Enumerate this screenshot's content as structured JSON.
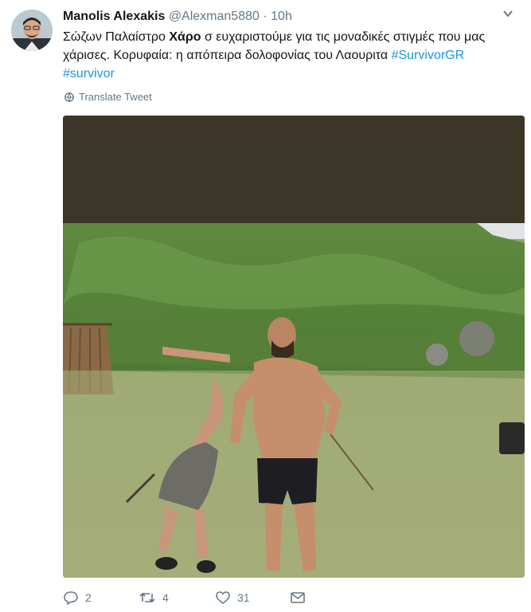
{
  "tweet": {
    "author_name": "Manolis Alexakis",
    "handle": "@Alexman5880",
    "separator": "·",
    "time": "10h",
    "text_before_bold": "Σώζων Παλαίστρο ",
    "text_bold": "Χάρο",
    "text_after_bold": " σ ευχαριστούμε για τις μοναδικές στιγμές που μας χάρισες. Κορυφαία: η απόπειρα δολοφονίας του Λαουριτα ",
    "hashtag_1": "#SurvivorGR",
    "hashtag_2": "#survivor",
    "translate_label": "Translate Tweet"
  },
  "actions": {
    "reply_count": "2",
    "retweet_count": "4",
    "like_count": "31"
  },
  "icons": {
    "caret": "chevron-down-icon",
    "translate": "globe-icon",
    "reply": "reply-icon",
    "retweet": "retweet-icon",
    "like": "heart-icon",
    "dm": "envelope-icon"
  },
  "colors": {
    "link": "#1b95e0",
    "muted": "#657786",
    "text": "#14171a"
  }
}
